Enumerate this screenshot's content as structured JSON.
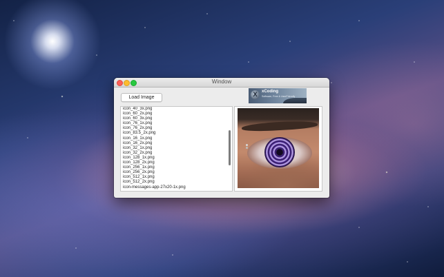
{
  "window": {
    "title": "Window",
    "load_button": "Load Image",
    "banner": {
      "logo_glyph": "X",
      "title": "xCoding",
      "tagline": "Software, Free & UserFriendly"
    },
    "files": [
      "icon_40_3x.png",
      "icon_60_2x.png",
      "icon_60_3x.png",
      "icon_76_1x.png",
      "icon_76_2x.png",
      "icon_83.5_2x.png",
      "icon_16_1x.png",
      "icon_16_2x.png",
      "icon_32_1x.png",
      "icon_32_2x.png",
      "icon_128_1x.png",
      "icon_128_2x.png",
      "icon_256_1x.png",
      "icon_256_2x.png",
      "icon_512_1x.png",
      "icon_512_2x.png",
      "icon-messages-app-27x20-1x.png"
    ]
  },
  "colors": {
    "close": "#fc5f57",
    "minimize": "#fdbc2e",
    "zoom": "#28c840"
  },
  "icons": {
    "close": "close-icon",
    "minimize": "minimize-icon",
    "zoom": "zoom-icon"
  }
}
